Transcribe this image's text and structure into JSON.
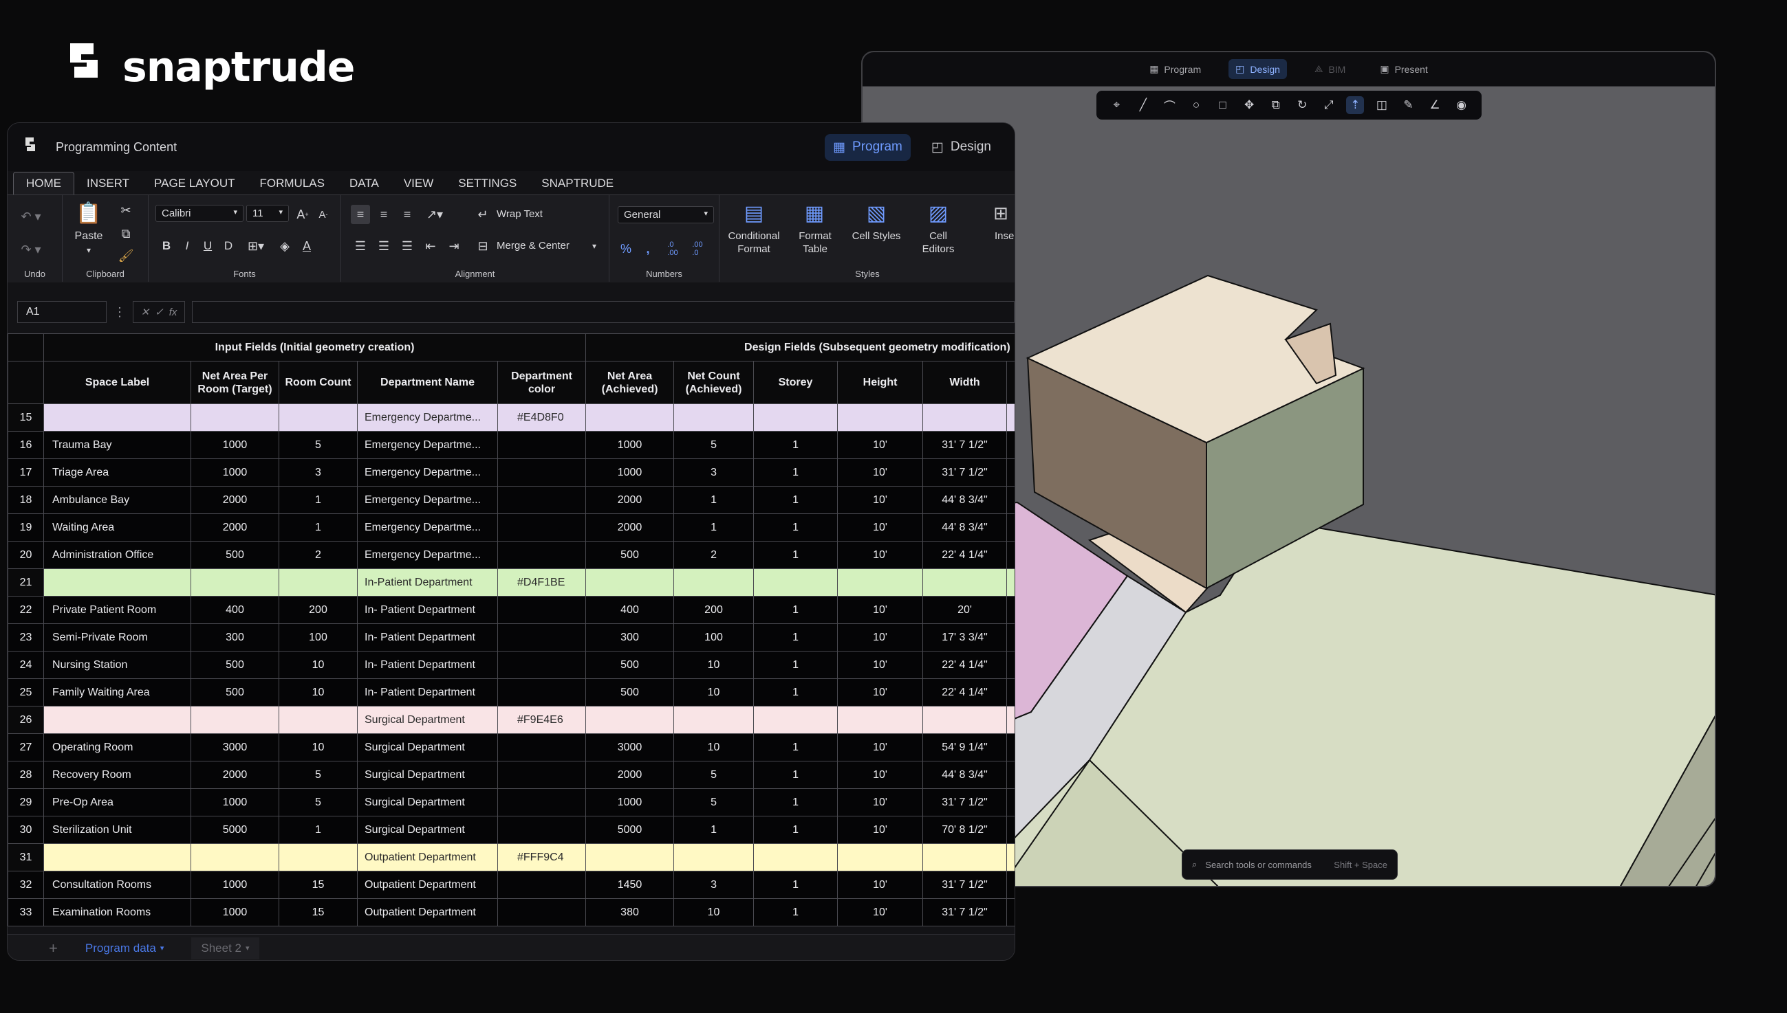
{
  "brand": {
    "name": "snaptrude"
  },
  "viewer": {
    "tabs": [
      {
        "label": "Program",
        "icon": "table-icon",
        "active": false
      },
      {
        "label": "Design",
        "icon": "design-icon",
        "active": true
      },
      {
        "label": "BIM",
        "icon": "bim-icon",
        "active": false
      },
      {
        "label": "Present",
        "icon": "present-icon",
        "active": false
      }
    ],
    "command_bar": {
      "placeholder": "Search tools or commands",
      "shortcut": "Shift + Space"
    }
  },
  "sheet": {
    "app_title": "Programming Content",
    "mode_tabs": {
      "program": "Program",
      "design": "Design"
    },
    "ribbon_tabs": [
      "HOME",
      "INSERT",
      "PAGE LAYOUT",
      "FORMULAS",
      "DATA",
      "VIEW",
      "SETTINGS",
      "SNAPTRUDE"
    ],
    "groups": {
      "undo": "Undo",
      "clipboard": "Clipboard",
      "fonts": "Fonts",
      "alignment": "Alignment",
      "numbers": "Numbers",
      "styles": "Styles"
    },
    "paste": "Paste",
    "font": "Calibri",
    "font_size": "11",
    "wrap_text": "Wrap Text",
    "merge_center": "Merge & Center",
    "number_format": "General",
    "styles": {
      "conditional_format": "Conditional Format",
      "format_table": "Format Table",
      "cell_styles": "Cell Styles",
      "cell_editors": "Cell Editors",
      "insert": "Insert"
    },
    "name_box": "A1",
    "fx": "fx",
    "group_headers": {
      "input": "Input Fields (Initial geometry creation)",
      "design": "Design Fields (Subsequent geometry modification)"
    },
    "columns": [
      "Space Label",
      "Net Area Per Room (Target)",
      "Room Count",
      "Department Name",
      "Department color",
      "Net Area (Achieved)",
      "Net Count (Achieved)",
      "Storey",
      "Height",
      "Width"
    ],
    "rows": [
      {
        "n": "15",
        "label": "",
        "area": "",
        "count": "",
        "dept": "Emergency Departme...",
        "color": "#E4D8F0",
        "ach": "",
        "nc": "",
        "storey": "",
        "height": "",
        "width": "",
        "fill": "#E4D8F0"
      },
      {
        "n": "16",
        "label": "Trauma Bay",
        "area": "1000",
        "count": "5",
        "dept": "Emergency Departme...",
        "color": "",
        "ach": "1000",
        "nc": "5",
        "storey": "1",
        "height": "10'",
        "width": "31' 7 1/2\"",
        "fill": ""
      },
      {
        "n": "17",
        "label": "Triage Area",
        "area": "1000",
        "count": "3",
        "dept": "Emergency Departme...",
        "color": "",
        "ach": "1000",
        "nc": "3",
        "storey": "1",
        "height": "10'",
        "width": "31' 7 1/2\"",
        "fill": ""
      },
      {
        "n": "18",
        "label": "Ambulance Bay",
        "area": "2000",
        "count": "1",
        "dept": "Emergency Departme...",
        "color": "",
        "ach": "2000",
        "nc": "1",
        "storey": "1",
        "height": "10'",
        "width": "44' 8 3/4\"",
        "fill": ""
      },
      {
        "n": "19",
        "label": "Waiting Area",
        "area": "2000",
        "count": "1",
        "dept": "Emergency Departme...",
        "color": "",
        "ach": "2000",
        "nc": "1",
        "storey": "1",
        "height": "10'",
        "width": "44' 8 3/4\"",
        "fill": ""
      },
      {
        "n": "20",
        "label": "Administration Office",
        "area": "500",
        "count": "2",
        "dept": "Emergency Departme...",
        "color": "",
        "ach": "500",
        "nc": "2",
        "storey": "1",
        "height": "10'",
        "width": "22' 4 1/4\"",
        "fill": ""
      },
      {
        "n": "21",
        "label": "",
        "area": "",
        "count": "",
        "dept": "In-Patient Department",
        "color": "#D4F1BE",
        "ach": "",
        "nc": "",
        "storey": "",
        "height": "",
        "width": "",
        "fill": "#D4F1BE"
      },
      {
        "n": "22",
        "label": "Private Patient Room",
        "area": "400",
        "count": "200",
        "dept": "In- Patient Department",
        "color": "",
        "ach": "400",
        "nc": "200",
        "storey": "1",
        "height": "10'",
        "width": "20'",
        "fill": ""
      },
      {
        "n": "23",
        "label": "Semi-Private Room",
        "area": "300",
        "count": "100",
        "dept": "In- Patient Department",
        "color": "",
        "ach": "300",
        "nc": "100",
        "storey": "1",
        "height": "10'",
        "width": "17' 3 3/4\"",
        "fill": ""
      },
      {
        "n": "24",
        "label": "Nursing Station",
        "area": "500",
        "count": "10",
        "dept": "In- Patient Department",
        "color": "",
        "ach": "500",
        "nc": "10",
        "storey": "1",
        "height": "10'",
        "width": "22' 4 1/4\"",
        "fill": ""
      },
      {
        "n": "25",
        "label": "Family Waiting Area",
        "area": "500",
        "count": "10",
        "dept": "In- Patient Department",
        "color": "",
        "ach": "500",
        "nc": "10",
        "storey": "1",
        "height": "10'",
        "width": "22' 4 1/4\"",
        "fill": ""
      },
      {
        "n": "26",
        "label": "",
        "area": "",
        "count": "",
        "dept": "Surgical Department",
        "color": "#F9E4E6",
        "ach": "",
        "nc": "",
        "storey": "",
        "height": "",
        "width": "",
        "fill": "#F9E4E6"
      },
      {
        "n": "27",
        "label": "Operating Room",
        "area": "3000",
        "count": "10",
        "dept": "Surgical Department",
        "color": "",
        "ach": "3000",
        "nc": "10",
        "storey": "1",
        "height": "10'",
        "width": "54' 9 1/4\"",
        "fill": ""
      },
      {
        "n": "28",
        "label": "Recovery Room",
        "area": "2000",
        "count": "5",
        "dept": "Surgical Department",
        "color": "",
        "ach": "2000",
        "nc": "5",
        "storey": "1",
        "height": "10'",
        "width": "44' 8 3/4\"",
        "fill": ""
      },
      {
        "n": "29",
        "label": "Pre-Op Area",
        "area": "1000",
        "count": "5",
        "dept": "Surgical Department",
        "color": "",
        "ach": "1000",
        "nc": "5",
        "storey": "1",
        "height": "10'",
        "width": "31' 7 1/2\"",
        "fill": ""
      },
      {
        "n": "30",
        "label": "Sterilization Unit",
        "area": "5000",
        "count": "1",
        "dept": "Surgical Department",
        "color": "",
        "ach": "5000",
        "nc": "1",
        "storey": "1",
        "height": "10'",
        "width": "70' 8 1/2\"",
        "fill": ""
      },
      {
        "n": "31",
        "label": "",
        "area": "",
        "count": "",
        "dept": "Outpatient Department",
        "color": "#FFF9C4",
        "ach": "",
        "nc": "",
        "storey": "",
        "height": "",
        "width": "",
        "fill": "#FFF9C4"
      },
      {
        "n": "32",
        "label": "Consultation Rooms",
        "area": "1000",
        "count": "15",
        "dept": "Outpatient Department",
        "color": "",
        "ach": "1450",
        "nc": "3",
        "storey": "1",
        "height": "10'",
        "width": "31' 7 1/2\"",
        "fill": ""
      },
      {
        "n": "33",
        "label": "Examination Rooms",
        "area": "1000",
        "count": "15",
        "dept": "Outpatient Department",
        "color": "",
        "ach": "380",
        "nc": "10",
        "storey": "1",
        "height": "10'",
        "width": "31' 7 1/2\"",
        "fill": ""
      }
    ],
    "sheet_tabs": [
      {
        "label": "Program data",
        "active": true
      },
      {
        "label": "Sheet 2",
        "active": false
      }
    ]
  }
}
